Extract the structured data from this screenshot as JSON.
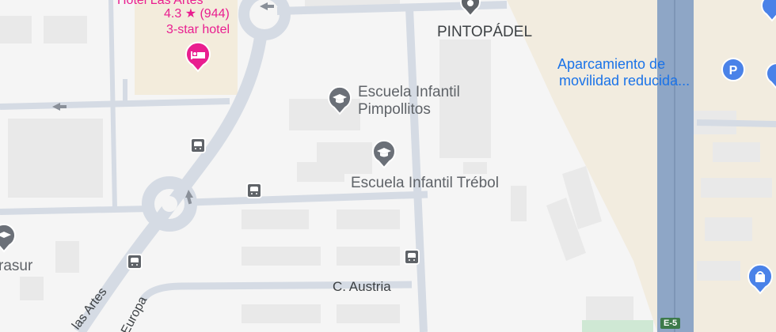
{
  "map": {
    "colors": {
      "background": "#f5f5f5",
      "road": "#d7dde6",
      "highway": "#8fa8c8",
      "sand_area": "#f3ecdf",
      "building": "#e8e8e8",
      "school_pin": "#5f6368",
      "hotel_pin": "#e91e8f",
      "parking_pin": "#4285f4"
    },
    "hotel": {
      "name": "Hotel Las Artes",
      "rating": "4.3 ★ (944)",
      "category": "3-star hotel"
    },
    "pois": {
      "pintopadel": "PINTOPÁDEL",
      "escuela_pimpollitos_line1": "Escuela Infantil",
      "escuela_pimpollitos_line2": "Pimpollitos",
      "escuela_trebol": "Escuela Infantil Trébol",
      "parking_line1": "Aparcamiento de",
      "parking_line2": "movilidad reducida...",
      "partial_left": "rasur"
    },
    "streets": {
      "austria": "C. Austria",
      "las_artes": "las Artes",
      "europa": "Europa"
    },
    "highway_shield": "E-5"
  }
}
